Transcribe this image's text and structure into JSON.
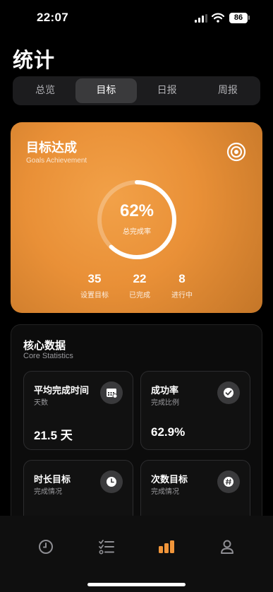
{
  "status_bar": {
    "time": "22:07",
    "battery": "86"
  },
  "page_title": "统计",
  "tabs": [
    {
      "label": "总览",
      "active": false
    },
    {
      "label": "目标",
      "active": true
    },
    {
      "label": "日报",
      "active": false
    },
    {
      "label": "周报",
      "active": false
    }
  ],
  "goal_card": {
    "title": "目标达成",
    "subtitle": "Goals Achievement",
    "icon": "target-icon",
    "progress_percent": 62,
    "progress_text": "62%",
    "progress_label": "总完成率",
    "stats": [
      {
        "value": "35",
        "label": "设置目标"
      },
      {
        "value": "22",
        "label": "已完成"
      },
      {
        "value": "8",
        "label": "进行中"
      }
    ],
    "colors": {
      "accent": "#E99037"
    }
  },
  "core_stats": {
    "title": "核心数据",
    "subtitle": "Core Statistics",
    "tiles": [
      {
        "title": "平均完成时间",
        "subtitle": "天数",
        "value": "21.5 天",
        "icon": "calendar-icon"
      },
      {
        "title": "成功率",
        "subtitle": "完成比例",
        "value": "62.9%",
        "icon": "checkmark-icon"
      },
      {
        "title": "时长目标",
        "subtitle": "完成情况",
        "value": "",
        "icon": "clock-icon"
      },
      {
        "title": "次数目标",
        "subtitle": "完成情况",
        "value": "",
        "icon": "hashtag-icon"
      }
    ]
  },
  "tab_bar": {
    "items": [
      {
        "icon": "clock-icon",
        "active": false
      },
      {
        "icon": "checklist-icon",
        "active": false
      },
      {
        "icon": "bar-chart-icon",
        "active": true
      },
      {
        "icon": "person-icon",
        "active": false
      }
    ],
    "active_color": "#F0953A",
    "inactive_color": "#8E8E93"
  }
}
